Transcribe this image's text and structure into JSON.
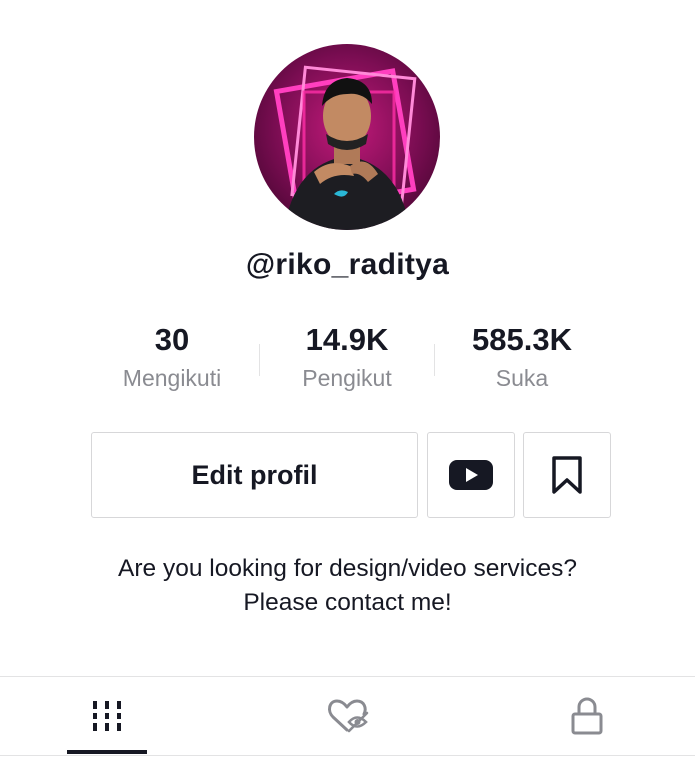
{
  "profile": {
    "username": "@riko_raditya",
    "avatar_icon": "profile-photo"
  },
  "stats": [
    {
      "value": "30",
      "label": "Mengikuti"
    },
    {
      "value": "14.9K",
      "label": "Pengikut"
    },
    {
      "value": "585.3K",
      "label": "Suka"
    }
  ],
  "actions": {
    "edit_label": "Edit profil",
    "youtube_icon": "youtube-icon",
    "bookmark_icon": "bookmark-icon"
  },
  "bio": {
    "line1": "Are you looking for design/video services?",
    "line2": "Please contact me!"
  },
  "tabs": [
    {
      "icon": "grid-icon",
      "active": true
    },
    {
      "icon": "liked-hidden-icon",
      "active": false
    },
    {
      "icon": "lock-icon",
      "active": false
    }
  ],
  "colors": {
    "text": "#161823",
    "secondary": "#8a8b91",
    "border": "#d7d7d9"
  }
}
